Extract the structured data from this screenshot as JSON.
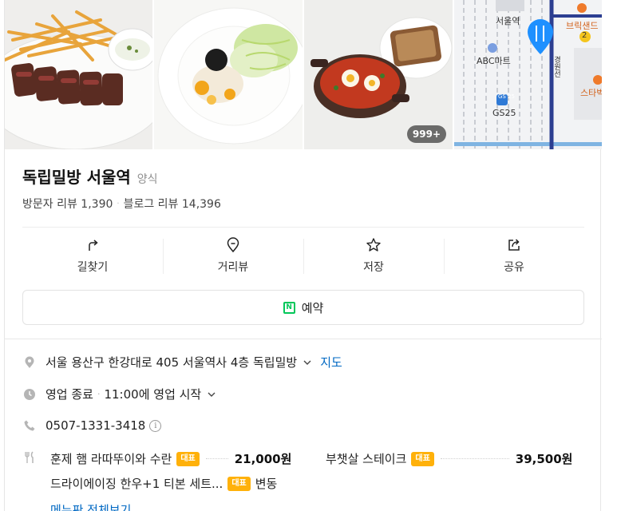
{
  "gallery": {
    "photo_count": "999+",
    "map_labels": {
      "station": "서울역",
      "store": "ABC마트",
      "convenience": "GS25",
      "cafe1": "브릭샌드",
      "cafe2": "스타벅",
      "exit": "2",
      "gs_badge": "GS 25",
      "road": "경원선"
    }
  },
  "place": {
    "name": "독립밀방 서울역",
    "category": "양식",
    "visitor_reviews": "방문자 리뷰 1,390",
    "blog_reviews": "블로그 리뷰 14,396"
  },
  "actions": [
    {
      "label": "길찾기",
      "icon": "directions-icon"
    },
    {
      "label": "거리뷰",
      "icon": "street-view-icon"
    },
    {
      "label": "저장",
      "icon": "star-icon"
    },
    {
      "label": "공유",
      "icon": "share-icon"
    }
  ],
  "reserve": {
    "label": "예약",
    "icon_text": "N"
  },
  "info": {
    "address": "서울 용산구 한강대로 405 서울역사 4층 독립밀방",
    "map_link": "지도",
    "status": "영업 종료",
    "status_detail": "11:00에 영업 시작",
    "phone": "0507-1331-3418",
    "info_mark": "i"
  },
  "menu": {
    "items": [
      {
        "name": "훈제 햄 라따뚜이와 수란",
        "tag": "대표",
        "price": "21,000원"
      },
      {
        "name": "부챗살 스테이크",
        "tag": "대표",
        "price": "39,500원"
      },
      {
        "name": "드라이에이징 한우+1 티본 세트...",
        "tag": "대표",
        "price": "변동"
      }
    ],
    "more_link": "메뉴판 전체보기"
  },
  "colors": {
    "accent_blue": "#0068c3",
    "tag_orange": "#ffb10a",
    "naver_green": "#03c75a",
    "map_pin": "#1e90ff"
  }
}
